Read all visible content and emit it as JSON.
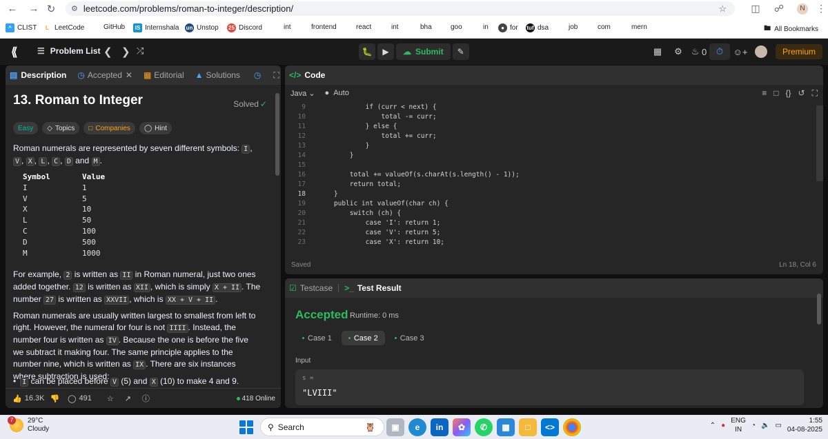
{
  "browser": {
    "url": "leetcode.com/problems/roman-to-integer/description/",
    "profile_initial": "N",
    "bookmarks": [
      "CLIST",
      "LeetCode",
      "GitHub",
      "Internshala",
      "Unstop",
      "Discord",
      "int",
      "frontend",
      "react",
      "int",
      "bha",
      "goo",
      "in",
      "for",
      "dsa",
      "job",
      "com",
      "mern"
    ],
    "all_bookmarks": "All Bookmarks"
  },
  "topbar": {
    "problem_list": "Problem List",
    "submit": "Submit",
    "streak": "0",
    "premium": "Premium"
  },
  "description": {
    "tabs": [
      "Description",
      "Accepted",
      "Editorial",
      "Solutions"
    ],
    "title": "13. Roman to Integer",
    "status": "Solved",
    "tags": [
      "Easy",
      "Topics",
      "Companies",
      "Hint"
    ],
    "intro_a": "Roman numerals are represented by seven different symbols: ",
    "intro_syms": [
      "I",
      "V",
      "X",
      "L",
      "C",
      "D",
      "M"
    ],
    "intro_and": " and ",
    "intro_end": ".",
    "table_headers": [
      "Symbol",
      "Value"
    ],
    "table_rows": [
      [
        "I",
        "1"
      ],
      [
        "V",
        "5"
      ],
      [
        "X",
        "10"
      ],
      [
        "L",
        "50"
      ],
      [
        "C",
        "100"
      ],
      [
        "D",
        "500"
      ],
      [
        "M",
        "1000"
      ]
    ],
    "p2": {
      "t1": "For example, ",
      "c1": "2",
      "t2": " is written as ",
      "c2": "II",
      "t3": " in Roman numeral, just two ones added together. ",
      "c3": "12",
      "t4": " is written as ",
      "c4": "XII",
      "t5": ", which is simply ",
      "c5": "X + II",
      "t6": ". The number ",
      "c6": "27",
      "t7": " is written as ",
      "c7": "XXVII",
      "t8": ", which is ",
      "c8": "XX + V + II",
      "t9": "."
    },
    "p3": {
      "t1": "Roman numerals are usually written largest to smallest from left to right. However, the numeral for four is not ",
      "c1": "IIII",
      "t2": ". Instead, the number four is written as ",
      "c2": "IV",
      "t3": ". Because the one is before the five we subtract it making four. The same principle applies to the number nine, which is written as ",
      "c3": "IX",
      "t4": ". There are six instances where subtraction is used:"
    },
    "bullet": {
      "c1": "I",
      "t1": " can be placed before ",
      "c2": "V",
      "t2": " (5) and ",
      "c3": "X",
      "t3": " (10) to make 4 and 9."
    },
    "likes": "16.3K",
    "comments": "491",
    "online": "418 Online"
  },
  "code": {
    "tab": "Code",
    "language": "Java",
    "mode": "Auto",
    "lines": [
      {
        "n": "9",
        "t": "            if (curr < next) {"
      },
      {
        "n": "10",
        "t": "                total -= curr;"
      },
      {
        "n": "11",
        "t": "            } else {"
      },
      {
        "n": "12",
        "t": "                total += curr;"
      },
      {
        "n": "13",
        "t": "            }"
      },
      {
        "n": "14",
        "t": "        }"
      },
      {
        "n": "15",
        "t": ""
      },
      {
        "n": "16",
        "t": "        total += valueOf(s.charAt(s.length() - 1));"
      },
      {
        "n": "17",
        "t": "        return total;"
      },
      {
        "n": "18",
        "t": "    }"
      },
      {
        "n": "19",
        "t": "    public int valueOf(char ch) {"
      },
      {
        "n": "20",
        "t": "        switch (ch) {"
      },
      {
        "n": "21",
        "t": "            case 'I': return 1;"
      },
      {
        "n": "22",
        "t": "            case 'V': return 5;"
      },
      {
        "n": "23",
        "t": "            case 'X': return 10;"
      }
    ],
    "saved": "Saved",
    "cursor": "Ln 18, Col 6"
  },
  "result": {
    "tabs": [
      "Testcase",
      "Test Result"
    ],
    "status": "Accepted",
    "runtime": "Runtime: 0 ms",
    "cases": [
      "Case 1",
      "Case 2",
      "Case 3"
    ],
    "input_label": "Input",
    "var": "s =",
    "value": "\"LVIII\""
  },
  "taskbar": {
    "temp": "29°C",
    "weather": "Cloudy",
    "weather_badge": "7",
    "search": "Search",
    "lang1": "ENG",
    "lang2": "IN",
    "time": "1:55",
    "date": "04-08-2025"
  }
}
